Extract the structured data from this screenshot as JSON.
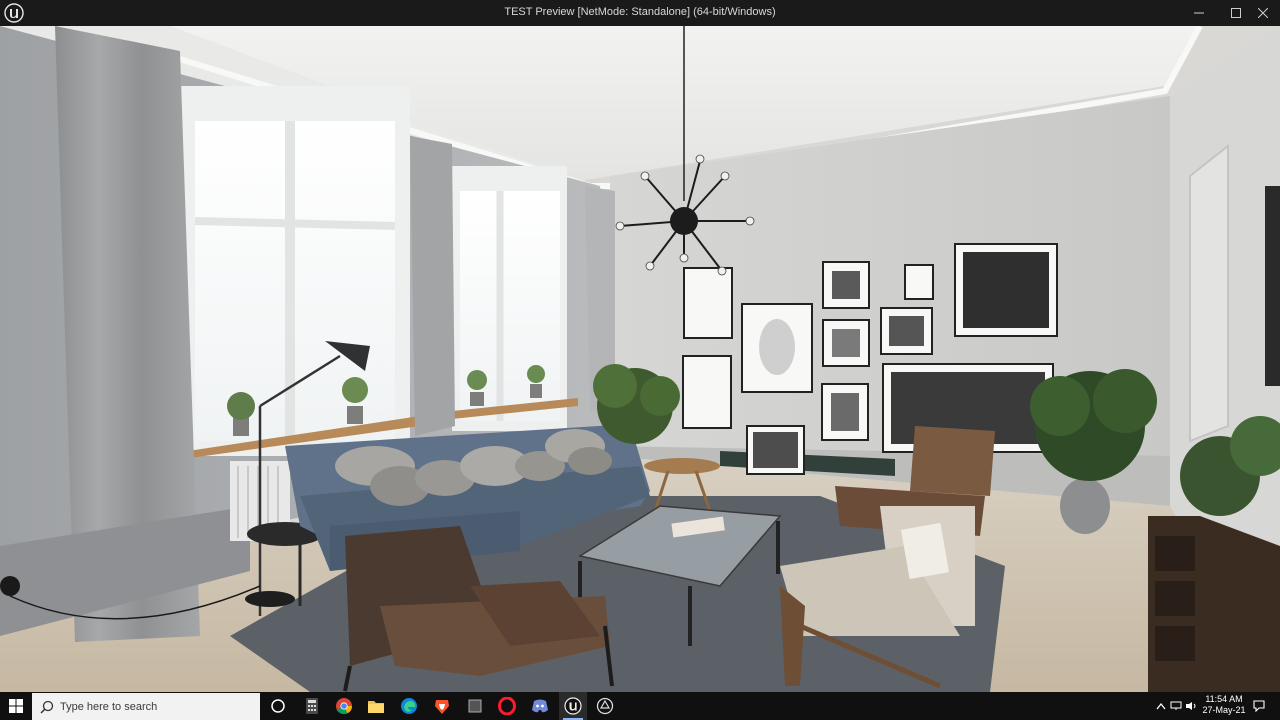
{
  "window": {
    "title": "TEST Preview [NetMode: Standalone]  (64-bit/Windows)",
    "controls": [
      "minimize",
      "maximize",
      "close"
    ]
  },
  "viewport": {
    "scene": "living-room"
  },
  "taskbar": {
    "search_placeholder": "Type here to search",
    "apps": [
      "task-view",
      "calculator",
      "chrome",
      "file-explorer",
      "edge",
      "brave",
      "unknown-app",
      "opera",
      "discord",
      "unreal-engine",
      "unity"
    ],
    "active_app": "unreal-engine",
    "clock": {
      "time": "11:54 AM",
      "date": "27-May-21"
    }
  },
  "colors": {
    "titlebar": "#1a1a1a",
    "taskbar": "#101010",
    "wall": "#cfd0cc",
    "sofa": "#5f7188",
    "floor": "#c9bfae",
    "rug": "#5a5f66"
  }
}
